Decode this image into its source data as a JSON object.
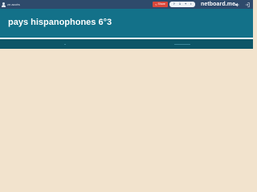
{
  "topbar": {
    "user_name": "ze.accès",
    "share_label": "Share",
    "pill_items": [
      "?",
      "1",
      "+",
      "i"
    ],
    "brand": "netboard.me"
  },
  "header": {
    "title": "pays hispanophones 6°3"
  },
  "icons": {
    "user": "user-icon",
    "share": "share-icon",
    "sound": "speaker-icon",
    "login": "login-icon"
  },
  "colors": {
    "topbar": "#2e4a6b",
    "header": "#137189",
    "columns_bar": "#0d5667",
    "board_background": "#f2e3cd",
    "share_button": "#d9473a"
  }
}
